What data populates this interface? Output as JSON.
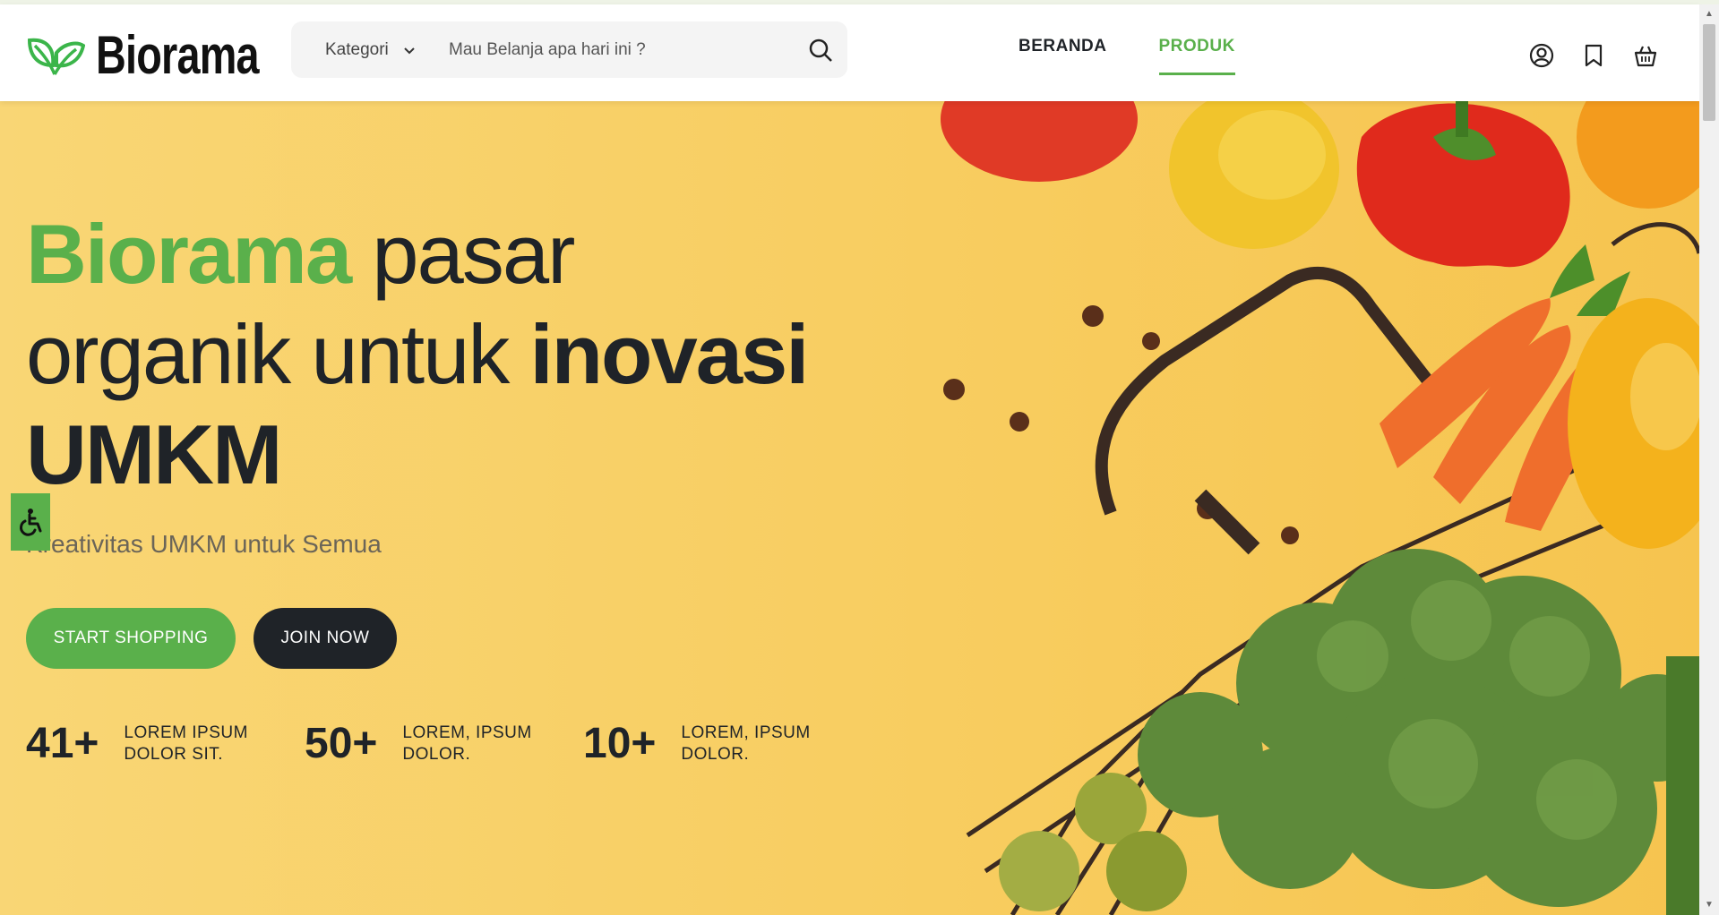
{
  "header": {
    "logo_text": "Biorama",
    "category_label": "Kategori",
    "search_placeholder": "Mau Belanja apa hari ini ?",
    "nav": [
      {
        "label": "BERANDA",
        "active": false
      },
      {
        "label": "PRODUK",
        "active": true
      }
    ],
    "icons": [
      "user-icon",
      "bookmark-icon",
      "basket-icon"
    ]
  },
  "hero": {
    "headline_brand": "Biorama",
    "headline_part1": " pasar",
    "headline_part2": "organik untuk ",
    "headline_bold1": "inovasi",
    "headline_bold2": "UMKM",
    "subtitle": "Kreativitas UMKM untuk Semua",
    "cta_primary": "START SHOPPING",
    "cta_secondary": "JOIN NOW",
    "stats": [
      {
        "number": "41+",
        "label_line1": "LOREM IPSUM",
        "label_line2": "DOLOR SIT."
      },
      {
        "number": "50+",
        "label_line1": "LOREM, IPSUM",
        "label_line2": "DOLOR."
      },
      {
        "number": "10+",
        "label_line1": "LOREM, IPSUM",
        "label_line2": "DOLOR."
      }
    ]
  },
  "colors": {
    "brand_green": "#5ab04b",
    "dark": "#1f2328",
    "hero_yellow": "#f8cd60"
  }
}
